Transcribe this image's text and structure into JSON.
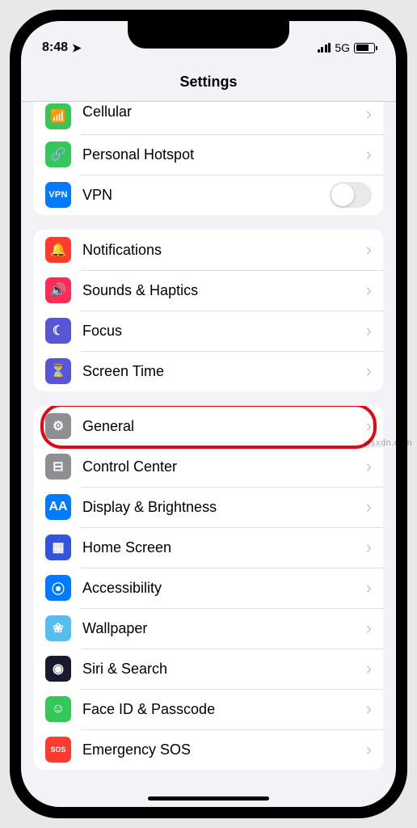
{
  "status": {
    "time": "8:48",
    "network": "5G"
  },
  "header": {
    "title": "Settings"
  },
  "groups": [
    {
      "rows": [
        {
          "label": "Cellular",
          "icon_bg": "#34c759",
          "icon_glyph": "📶",
          "accessory": "chevron"
        },
        {
          "label": "Personal Hotspot",
          "icon_bg": "#34c759",
          "icon_glyph": "🔗",
          "accessory": "chevron"
        },
        {
          "label": "VPN",
          "icon_type": "vpn",
          "accessory": "toggle",
          "toggle_on": false
        }
      ]
    },
    {
      "rows": [
        {
          "label": "Notifications",
          "icon_bg": "#ff3b30",
          "icon_glyph": "🔔",
          "accessory": "chevron"
        },
        {
          "label": "Sounds & Haptics",
          "icon_bg": "#ff2d55",
          "icon_glyph": "🔊",
          "accessory": "chevron"
        },
        {
          "label": "Focus",
          "icon_bg": "#5856d6",
          "icon_glyph": "☾",
          "accessory": "chevron"
        },
        {
          "label": "Screen Time",
          "icon_bg": "#5856d6",
          "icon_glyph": "⏳",
          "accessory": "chevron"
        }
      ]
    },
    {
      "rows": [
        {
          "label": "General",
          "icon_bg": "#8e8e93",
          "icon_glyph": "⚙",
          "accessory": "chevron",
          "highlighted": true
        },
        {
          "label": "Control Center",
          "icon_bg": "#8e8e93",
          "icon_glyph": "⊟",
          "accessory": "chevron"
        },
        {
          "label": "Display & Brightness",
          "icon_bg": "#007aff",
          "icon_glyph": "AA",
          "accessory": "chevron"
        },
        {
          "label": "Home Screen",
          "icon_bg": "#3355dd",
          "icon_glyph": "▦",
          "accessory": "chevron"
        },
        {
          "label": "Accessibility",
          "icon_bg": "#007aff",
          "icon_glyph": "⦿",
          "accessory": "chevron"
        },
        {
          "label": "Wallpaper",
          "icon_bg": "#55bef0",
          "icon_glyph": "❀",
          "accessory": "chevron"
        },
        {
          "label": "Siri & Search",
          "icon_bg": "#1a1a2e",
          "icon_glyph": "◉",
          "accessory": "chevron"
        },
        {
          "label": "Face ID & Passcode",
          "icon_bg": "#34c759",
          "icon_glyph": "☺",
          "accessory": "chevron"
        },
        {
          "label": "Emergency SOS",
          "icon_bg": "#ff3b30",
          "icon_glyph": "SOS",
          "accessory": "chevron"
        }
      ]
    }
  ],
  "watermark": "wsxdn.com"
}
